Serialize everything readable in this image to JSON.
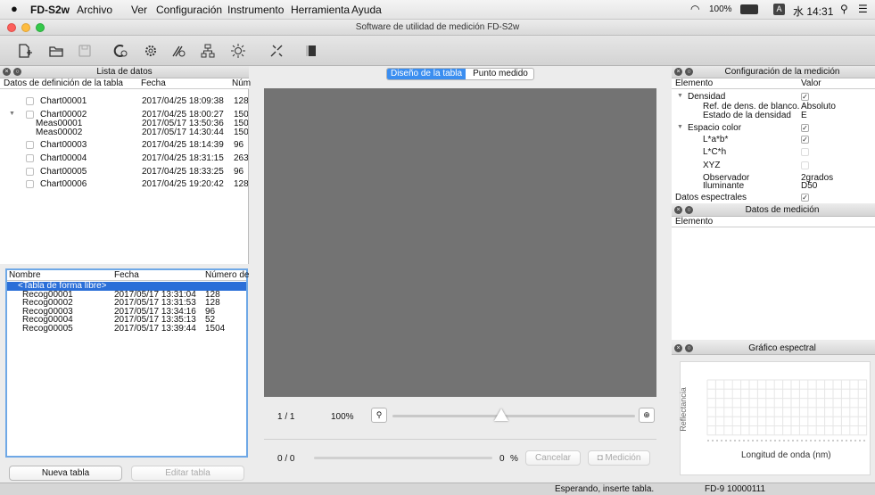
{
  "menubar": {
    "app": "FD-S2w",
    "items": [
      "Archivo",
      "Ver",
      "Configuración",
      "Instrumento",
      "Herramienta",
      "Ayuda"
    ],
    "battery": "100%",
    "input": "A",
    "clock": "水 14:31"
  },
  "window": {
    "title": "Software de utilidad de medición FD-S2w"
  },
  "toolbar": [
    "new-chart-icon",
    "open-folder-icon",
    "save-icon",
    "calibrate-icon",
    "settings-gear-icon",
    "measure-settings-icon",
    "network-icon",
    "brightness-icon",
    "chart-edit-icon",
    "color-patch-icon"
  ],
  "datalist": {
    "title": "Lista de datos",
    "cols": [
      "Datos de definición de la tabla",
      "Fecha",
      "Núm"
    ],
    "rows": [
      {
        "name": "Chart00001",
        "date": "2017/04/25 18:09:38",
        "num": "128",
        "cb": true
      },
      {
        "name": "Chart00002",
        "date": "2017/04/25 18:00:27",
        "num": "150",
        "cb": true,
        "open": true
      },
      {
        "name": "Meas00001",
        "date": "2017/05/17 13:50:36",
        "num": "150",
        "child": true
      },
      {
        "name": "Meas00002",
        "date": "2017/05/17 14:30:44",
        "num": "150",
        "child": true
      },
      {
        "name": "Chart00003",
        "date": "2017/04/25 18:14:39",
        "num": "96",
        "cb": true
      },
      {
        "name": "Chart00004",
        "date": "2017/04/25 18:31:15",
        "num": "263",
        "cb": true
      },
      {
        "name": "Chart00005",
        "date": "2017/04/25 18:33:25",
        "num": "96",
        "cb": true
      },
      {
        "name": "Chart00006",
        "date": "2017/04/25 19:20:42",
        "num": "128",
        "cb": true
      }
    ]
  },
  "recoglist": {
    "cols": [
      "Nombre",
      "Fecha",
      "Número de"
    ],
    "rows": [
      {
        "name": "<Tabla de forma libre>",
        "date": "",
        "num": "",
        "selected": true
      },
      {
        "name": "Recog00001",
        "date": "2017/05/17 13:31:04",
        "num": "128"
      },
      {
        "name": "Recog00002",
        "date": "2017/05/17 13:31:53",
        "num": "128"
      },
      {
        "name": "Recog00003",
        "date": "2017/05/17 13:34:16",
        "num": "96"
      },
      {
        "name": "Recog00004",
        "date": "2017/05/17 13:35:13",
        "num": "52"
      },
      {
        "name": "Recog00005",
        "date": "2017/05/17 13:39:44",
        "num": "1504"
      }
    ]
  },
  "buttons": {
    "new_table": "Nueva tabla",
    "edit_table": "Editar tabla",
    "cancel": "Cancelar",
    "measure": "Medición"
  },
  "center": {
    "tabs": [
      "Diseño de la tabla",
      "Punto medido"
    ],
    "page": "1 / 1",
    "zoom": "100%",
    "zoom_slider_level": 0.45,
    "progress": "0 / 0",
    "percent": "0",
    "percent_unit": "%"
  },
  "config": {
    "title": "Configuración de la medición",
    "cols": [
      "Elemento",
      "Valor"
    ],
    "rows": [
      {
        "label": "Densidad",
        "val": "check",
        "arrow": true
      },
      {
        "label": "Ref. de dens. de blanco.",
        "val": "Absoluto",
        "indent": 2
      },
      {
        "label": "Estado de la densidad",
        "val": "E",
        "indent": 2
      },
      {
        "label": "Espacio color",
        "val": "check",
        "arrow": true
      },
      {
        "label": "L*a*b*",
        "val": "check",
        "indent": 2
      },
      {
        "label": "L*C*h",
        "val": "empty",
        "indent": 2
      },
      {
        "label": "XYZ",
        "val": "empty",
        "indent": 2
      },
      {
        "label": "Observador",
        "val": "2grados",
        "indent": 2
      },
      {
        "label": "Iluminante",
        "val": "D50",
        "indent": 2
      },
      {
        "label": "Datos espectrales",
        "val": "check",
        "indent": 1
      }
    ]
  },
  "measdata": {
    "title": "Datos de medición",
    "col": "Elemento"
  },
  "spectral": {
    "title": "Gráfico espectral",
    "ylabel": "Reflectancia",
    "xlabel": "Longitud de onda (nm)"
  },
  "status": {
    "message": "Esperando, inserte tabla.",
    "device": "FD-9 10000111"
  }
}
